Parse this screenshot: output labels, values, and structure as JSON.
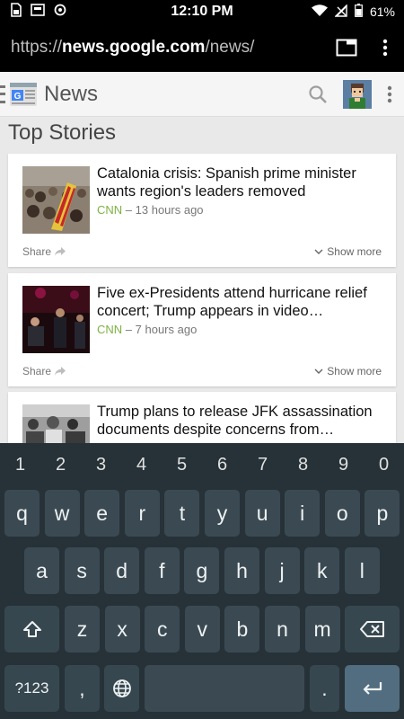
{
  "status_bar": {
    "time": "12:10 PM",
    "battery": "61%",
    "icons": [
      "sim-icon",
      "photo-icon",
      "sync-icon",
      "wifi-icon",
      "signal-icon",
      "battery-icon"
    ]
  },
  "browser": {
    "url_prefix": "https://",
    "url_host": "news.google.com",
    "url_path": "/news/"
  },
  "app_bar": {
    "title": "News",
    "logo_letter": "G"
  },
  "section_title": "Top Stories",
  "stories": [
    {
      "title": "Catalonia crisis: Spanish prime minister wants region's leaders removed",
      "source": "CNN",
      "time": "– 13 hours ago",
      "share_label": "Share",
      "more_label": "Show more"
    },
    {
      "title": "Five ex-Presidents attend hurricane relief concert; Trump appears in video…",
      "source": "CNN",
      "time": "– 7 hours ago",
      "share_label": "Share",
      "more_label": "Show more"
    },
    {
      "title": "Trump plans to release JFK assassination documents despite concerns from…"
    }
  ],
  "keyboard": {
    "numbers": [
      "1",
      "2",
      "3",
      "4",
      "5",
      "6",
      "7",
      "8",
      "9",
      "0"
    ],
    "row1": [
      "q",
      "w",
      "e",
      "r",
      "t",
      "y",
      "u",
      "i",
      "o",
      "p"
    ],
    "row2": [
      "a",
      "s",
      "d",
      "f",
      "g",
      "h",
      "j",
      "k",
      "l"
    ],
    "row3": [
      "z",
      "x",
      "c",
      "v",
      "b",
      "n",
      "m"
    ],
    "symbols_label": "?123",
    "comma": ",",
    "period": "."
  },
  "colors": {
    "source_green": "#7cb342",
    "keyboard_bg": "#263238",
    "key_bg": "#3b4a52"
  }
}
